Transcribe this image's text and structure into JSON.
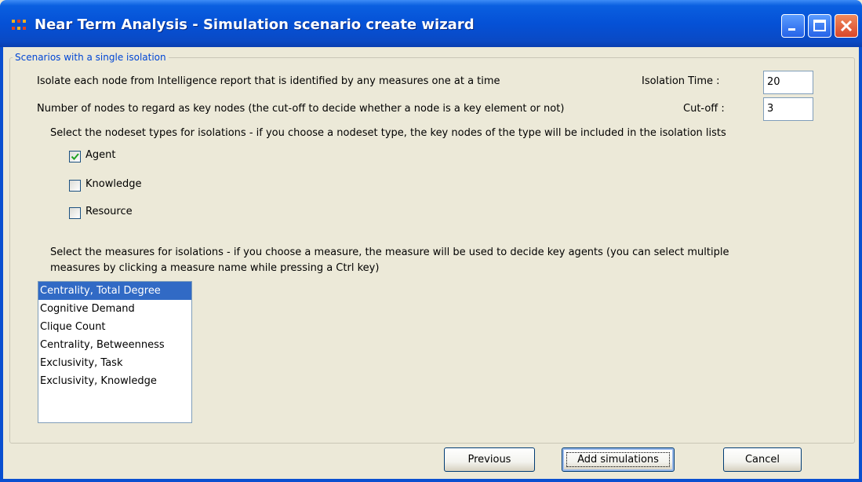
{
  "window": {
    "title": "Near Term Analysis - Simulation scenario create wizard",
    "controls": [
      "minimize-icon",
      "maximize-icon",
      "close-icon"
    ],
    "accent": "#0a5fe0"
  },
  "group": {
    "legend": "Scenarios with a single isolation"
  },
  "isolation": {
    "description": "Isolate each node from Intelligence report that is identified by any measures one at a time",
    "time_label": "Isolation Time :",
    "time_value": "20"
  },
  "cutoff": {
    "description": "Number of nodes to regard as key nodes (the cut-off to decide whether a node is a key element or not)",
    "label": "Cut-off :",
    "value": "3"
  },
  "nodeset": {
    "instruction": "Select the nodeset types for isolations - if you choose a nodeset type, the key nodes of the type will be included in the isolation lists",
    "options": [
      {
        "label": "Agent",
        "checked": true
      },
      {
        "label": "Knowledge",
        "checked": false
      },
      {
        "label": "Resource",
        "checked": false
      }
    ]
  },
  "measures": {
    "instruction_line1": "Select the measures for isolations - if you choose a measure, the measure will be used to decide key agents (you can select multiple",
    "instruction_line2": "measures by clicking a measure name while pressing a Ctrl key)",
    "items": [
      {
        "label": "Centrality, Total Degree",
        "selected": true
      },
      {
        "label": "Cognitive Demand",
        "selected": false
      },
      {
        "label": "Clique Count",
        "selected": false
      },
      {
        "label": "Centrality, Betweenness",
        "selected": false
      },
      {
        "label": "Exclusivity, Task",
        "selected": false
      },
      {
        "label": "Exclusivity, Knowledge",
        "selected": false
      }
    ],
    "selection_color": "#316ac5"
  },
  "buttons": {
    "previous": "Previous",
    "add": "Add simulations",
    "cancel": "Cancel"
  }
}
